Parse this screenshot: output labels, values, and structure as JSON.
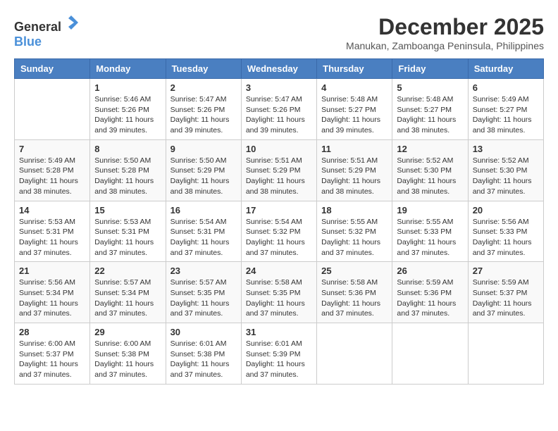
{
  "header": {
    "logo_general": "General",
    "logo_blue": "Blue",
    "month_title": "December 2025",
    "location": "Manukan, Zamboanga Peninsula, Philippines"
  },
  "days_of_week": [
    "Sunday",
    "Monday",
    "Tuesday",
    "Wednesday",
    "Thursday",
    "Friday",
    "Saturday"
  ],
  "weeks": [
    [
      {
        "day": "",
        "sunrise": "",
        "sunset": "",
        "daylight": ""
      },
      {
        "day": "1",
        "sunrise": "Sunrise: 5:46 AM",
        "sunset": "Sunset: 5:26 PM",
        "daylight": "Daylight: 11 hours and 39 minutes."
      },
      {
        "day": "2",
        "sunrise": "Sunrise: 5:47 AM",
        "sunset": "Sunset: 5:26 PM",
        "daylight": "Daylight: 11 hours and 39 minutes."
      },
      {
        "day": "3",
        "sunrise": "Sunrise: 5:47 AM",
        "sunset": "Sunset: 5:26 PM",
        "daylight": "Daylight: 11 hours and 39 minutes."
      },
      {
        "day": "4",
        "sunrise": "Sunrise: 5:48 AM",
        "sunset": "Sunset: 5:27 PM",
        "daylight": "Daylight: 11 hours and 39 minutes."
      },
      {
        "day": "5",
        "sunrise": "Sunrise: 5:48 AM",
        "sunset": "Sunset: 5:27 PM",
        "daylight": "Daylight: 11 hours and 38 minutes."
      },
      {
        "day": "6",
        "sunrise": "Sunrise: 5:49 AM",
        "sunset": "Sunset: 5:27 PM",
        "daylight": "Daylight: 11 hours and 38 minutes."
      }
    ],
    [
      {
        "day": "7",
        "sunrise": "Sunrise: 5:49 AM",
        "sunset": "Sunset: 5:28 PM",
        "daylight": "Daylight: 11 hours and 38 minutes."
      },
      {
        "day": "8",
        "sunrise": "Sunrise: 5:50 AM",
        "sunset": "Sunset: 5:28 PM",
        "daylight": "Daylight: 11 hours and 38 minutes."
      },
      {
        "day": "9",
        "sunrise": "Sunrise: 5:50 AM",
        "sunset": "Sunset: 5:29 PM",
        "daylight": "Daylight: 11 hours and 38 minutes."
      },
      {
        "day": "10",
        "sunrise": "Sunrise: 5:51 AM",
        "sunset": "Sunset: 5:29 PM",
        "daylight": "Daylight: 11 hours and 38 minutes."
      },
      {
        "day": "11",
        "sunrise": "Sunrise: 5:51 AM",
        "sunset": "Sunset: 5:29 PM",
        "daylight": "Daylight: 11 hours and 38 minutes."
      },
      {
        "day": "12",
        "sunrise": "Sunrise: 5:52 AM",
        "sunset": "Sunset: 5:30 PM",
        "daylight": "Daylight: 11 hours and 38 minutes."
      },
      {
        "day": "13",
        "sunrise": "Sunrise: 5:52 AM",
        "sunset": "Sunset: 5:30 PM",
        "daylight": "Daylight: 11 hours and 37 minutes."
      }
    ],
    [
      {
        "day": "14",
        "sunrise": "Sunrise: 5:53 AM",
        "sunset": "Sunset: 5:31 PM",
        "daylight": "Daylight: 11 hours and 37 minutes."
      },
      {
        "day": "15",
        "sunrise": "Sunrise: 5:53 AM",
        "sunset": "Sunset: 5:31 PM",
        "daylight": "Daylight: 11 hours and 37 minutes."
      },
      {
        "day": "16",
        "sunrise": "Sunrise: 5:54 AM",
        "sunset": "Sunset: 5:31 PM",
        "daylight": "Daylight: 11 hours and 37 minutes."
      },
      {
        "day": "17",
        "sunrise": "Sunrise: 5:54 AM",
        "sunset": "Sunset: 5:32 PM",
        "daylight": "Daylight: 11 hours and 37 minutes."
      },
      {
        "day": "18",
        "sunrise": "Sunrise: 5:55 AM",
        "sunset": "Sunset: 5:32 PM",
        "daylight": "Daylight: 11 hours and 37 minutes."
      },
      {
        "day": "19",
        "sunrise": "Sunrise: 5:55 AM",
        "sunset": "Sunset: 5:33 PM",
        "daylight": "Daylight: 11 hours and 37 minutes."
      },
      {
        "day": "20",
        "sunrise": "Sunrise: 5:56 AM",
        "sunset": "Sunset: 5:33 PM",
        "daylight": "Daylight: 11 hours and 37 minutes."
      }
    ],
    [
      {
        "day": "21",
        "sunrise": "Sunrise: 5:56 AM",
        "sunset": "Sunset: 5:34 PM",
        "daylight": "Daylight: 11 hours and 37 minutes."
      },
      {
        "day": "22",
        "sunrise": "Sunrise: 5:57 AM",
        "sunset": "Sunset: 5:34 PM",
        "daylight": "Daylight: 11 hours and 37 minutes."
      },
      {
        "day": "23",
        "sunrise": "Sunrise: 5:57 AM",
        "sunset": "Sunset: 5:35 PM",
        "daylight": "Daylight: 11 hours and 37 minutes."
      },
      {
        "day": "24",
        "sunrise": "Sunrise: 5:58 AM",
        "sunset": "Sunset: 5:35 PM",
        "daylight": "Daylight: 11 hours and 37 minutes."
      },
      {
        "day": "25",
        "sunrise": "Sunrise: 5:58 AM",
        "sunset": "Sunset: 5:36 PM",
        "daylight": "Daylight: 11 hours and 37 minutes."
      },
      {
        "day": "26",
        "sunrise": "Sunrise: 5:59 AM",
        "sunset": "Sunset: 5:36 PM",
        "daylight": "Daylight: 11 hours and 37 minutes."
      },
      {
        "day": "27",
        "sunrise": "Sunrise: 5:59 AM",
        "sunset": "Sunset: 5:37 PM",
        "daylight": "Daylight: 11 hours and 37 minutes."
      }
    ],
    [
      {
        "day": "28",
        "sunrise": "Sunrise: 6:00 AM",
        "sunset": "Sunset: 5:37 PM",
        "daylight": "Daylight: 11 hours and 37 minutes."
      },
      {
        "day": "29",
        "sunrise": "Sunrise: 6:00 AM",
        "sunset": "Sunset: 5:38 PM",
        "daylight": "Daylight: 11 hours and 37 minutes."
      },
      {
        "day": "30",
        "sunrise": "Sunrise: 6:01 AM",
        "sunset": "Sunset: 5:38 PM",
        "daylight": "Daylight: 11 hours and 37 minutes."
      },
      {
        "day": "31",
        "sunrise": "Sunrise: 6:01 AM",
        "sunset": "Sunset: 5:39 PM",
        "daylight": "Daylight: 11 hours and 37 minutes."
      },
      {
        "day": "",
        "sunrise": "",
        "sunset": "",
        "daylight": ""
      },
      {
        "day": "",
        "sunrise": "",
        "sunset": "",
        "daylight": ""
      },
      {
        "day": "",
        "sunrise": "",
        "sunset": "",
        "daylight": ""
      }
    ]
  ]
}
